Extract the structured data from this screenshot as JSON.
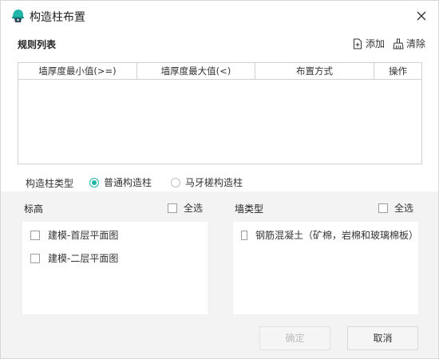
{
  "window": {
    "title": "构造柱布置",
    "accent": "#1fb6a9"
  },
  "rules": {
    "title": "规则列表",
    "add_label": "添加",
    "clear_label": "清除",
    "columns": [
      "墙厚度最小值(>=)",
      "墙厚度最大值(<)",
      "布置方式",
      "操作"
    ],
    "rows": []
  },
  "column_type": {
    "label": "构造柱类型",
    "options": [
      {
        "label": "普通构造柱",
        "checked": true
      },
      {
        "label": "马牙槎构造柱",
        "checked": false
      }
    ]
  },
  "elevation": {
    "title": "标高",
    "select_all": "全选",
    "items": [
      "建模-首层平面图",
      "建模-二层平面图"
    ]
  },
  "wall_type": {
    "title": "墙类型",
    "select_all": "全选",
    "items": [
      "钢筋混凝土（矿棉，岩棉和玻璃棉板）"
    ]
  },
  "buttons": {
    "ok": "确定",
    "cancel": "取消"
  }
}
